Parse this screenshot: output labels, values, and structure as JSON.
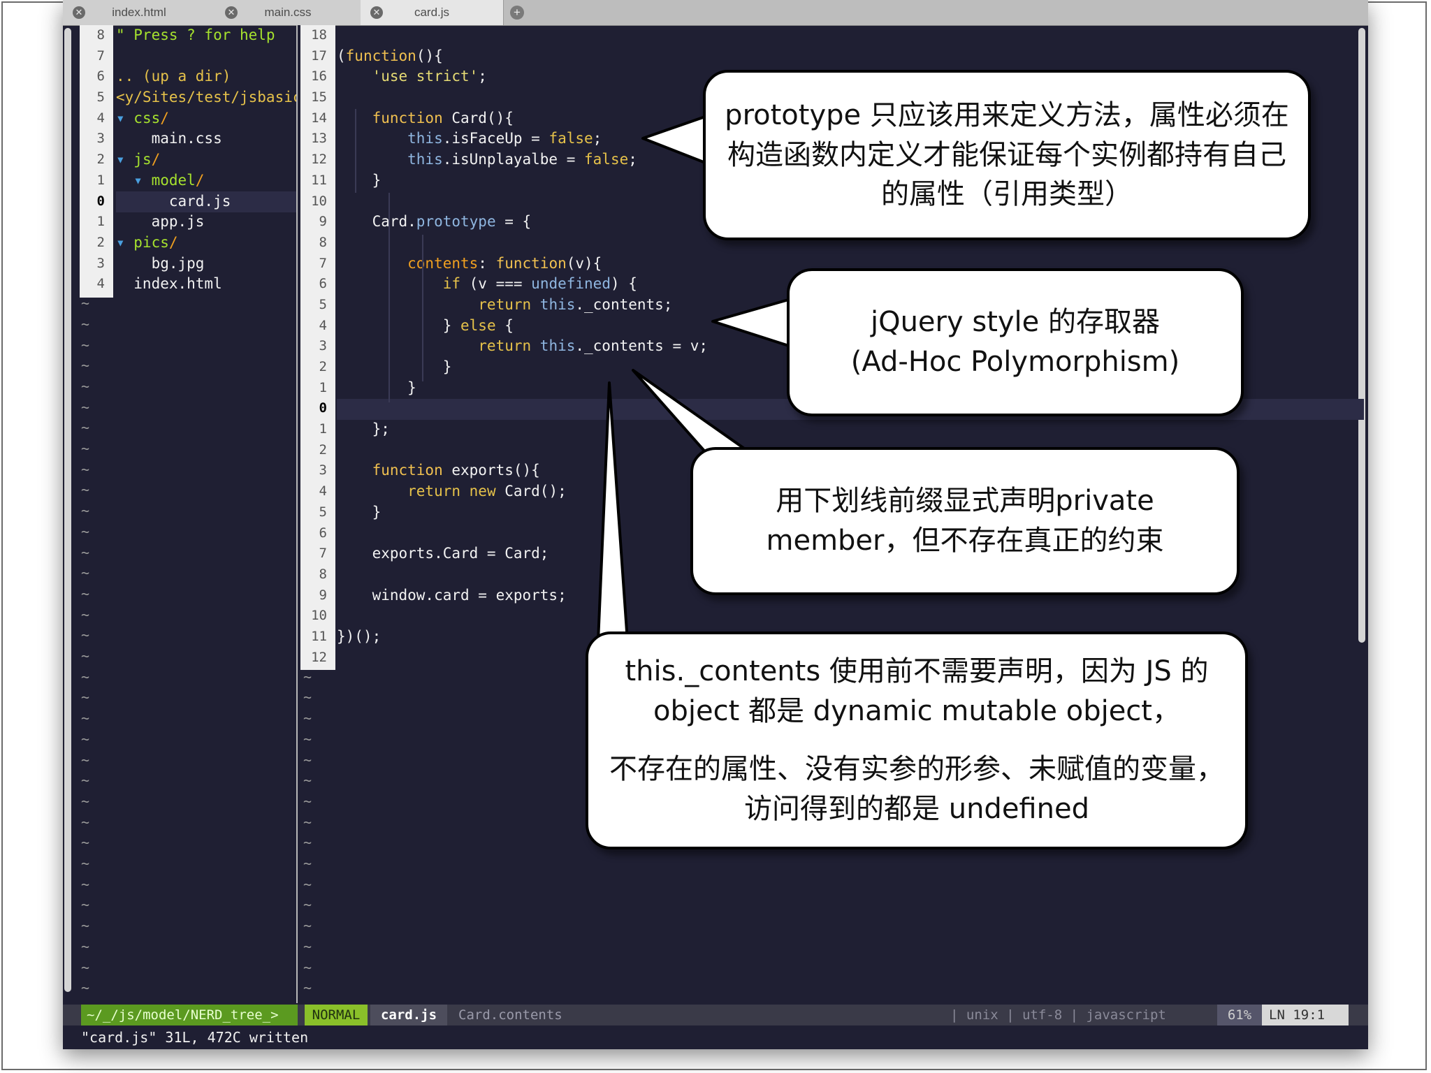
{
  "tabs": [
    {
      "label": "index.html"
    },
    {
      "label": "main.css"
    },
    {
      "label": "card.js"
    }
  ],
  "tree": {
    "line_numbers": [
      "8",
      "7",
      "6",
      "5",
      "4",
      "3",
      "2",
      "1",
      "0",
      "1",
      "2",
      "3",
      "4"
    ],
    "rows": [
      {
        "parts": [
          {
            "t": "\" Press ? for help",
            "c": "grn"
          }
        ]
      },
      {
        "parts": [
          {
            "t": "",
            "c": "wht"
          }
        ]
      },
      {
        "parts": [
          {
            "t": ".. (up a dir)",
            "c": "yel"
          }
        ]
      },
      {
        "parts": [
          {
            "t": "<y/Sites/test/jsbasic/",
            "c": "yel"
          }
        ]
      },
      {
        "parts": [
          {
            "t": "▾ ",
            "c": "blue-arrow"
          },
          {
            "t": "css",
            "c": "grn"
          },
          {
            "t": "/",
            "c": "org"
          }
        ]
      },
      {
        "parts": [
          {
            "t": "    main.css",
            "c": "wht"
          }
        ]
      },
      {
        "parts": [
          {
            "t": "▾ ",
            "c": "blue-arrow"
          },
          {
            "t": "js",
            "c": "grn"
          },
          {
            "t": "/",
            "c": "org"
          }
        ]
      },
      {
        "parts": [
          {
            "t": "  ▾ ",
            "c": "blue-arrow"
          },
          {
            "t": "model",
            "c": "grn"
          },
          {
            "t": "/",
            "c": "org"
          }
        ]
      },
      {
        "parts": [
          {
            "t": "      card.js",
            "c": "wht"
          }
        ]
      },
      {
        "parts": [
          {
            "t": "    app.js",
            "c": "wht"
          }
        ]
      },
      {
        "parts": [
          {
            "t": "▾ ",
            "c": "blue-arrow"
          },
          {
            "t": "pics",
            "c": "grn"
          },
          {
            "t": "/",
            "c": "org"
          }
        ]
      },
      {
        "parts": [
          {
            "t": "    bg.jpg",
            "c": "wht"
          }
        ]
      },
      {
        "parts": [
          {
            "t": "  index.html",
            "c": "wht"
          }
        ]
      }
    ]
  },
  "code": {
    "line_numbers": [
      "18",
      "17",
      "16",
      "15",
      "14",
      "13",
      "12",
      "11",
      "10",
      "9",
      "8",
      "7",
      "6",
      "5",
      "4",
      "3",
      "2",
      "1",
      "0",
      "1",
      "2",
      "3",
      "4",
      "5",
      "6",
      "7",
      "8",
      "9",
      "10",
      "11",
      "12"
    ],
    "rows": [
      {
        "parts": []
      },
      {
        "parts": [
          {
            "t": "(",
            "c": "wht"
          },
          {
            "t": "function",
            "c": "fn"
          },
          {
            "t": "(){",
            "c": "wht"
          }
        ]
      },
      {
        "parts": [
          {
            "t": "    'use strict'",
            "c": "str"
          },
          {
            "t": ";",
            "c": "wht"
          }
        ]
      },
      {
        "parts": []
      },
      {
        "parts": [
          {
            "t": "    ",
            "c": "wht"
          },
          {
            "t": "function",
            "c": "fn"
          },
          {
            "t": " Card(){",
            "c": "wht"
          }
        ]
      },
      {
        "parts": [
          {
            "t": "        this",
            "c": "th"
          },
          {
            "t": ".isFaceUp = ",
            "c": "wht"
          },
          {
            "t": "false",
            "c": "yel"
          },
          {
            "t": ";",
            "c": "wht"
          }
        ]
      },
      {
        "parts": [
          {
            "t": "        this",
            "c": "th"
          },
          {
            "t": ".isUnplayalbe = ",
            "c": "wht"
          },
          {
            "t": "false",
            "c": "yel"
          },
          {
            "t": ";",
            "c": "wht"
          }
        ]
      },
      {
        "parts": [
          {
            "t": "    }",
            "c": "wht"
          }
        ]
      },
      {
        "parts": []
      },
      {
        "parts": [
          {
            "t": "    Card.",
            "c": "wht"
          },
          {
            "t": "prototype",
            "c": "th"
          },
          {
            "t": " = {",
            "c": "wht"
          }
        ]
      },
      {
        "parts": []
      },
      {
        "parts": [
          {
            "t": "        contents",
            "c": "org"
          },
          {
            "t": ": ",
            "c": "wht"
          },
          {
            "t": "function",
            "c": "fn"
          },
          {
            "t": "(v){",
            "c": "wht"
          }
        ]
      },
      {
        "parts": [
          {
            "t": "            if",
            "c": "yel"
          },
          {
            "t": " (v === ",
            "c": "wht"
          },
          {
            "t": "undefined",
            "c": "th"
          },
          {
            "t": ") {",
            "c": "wht"
          }
        ]
      },
      {
        "parts": [
          {
            "t": "                return",
            "c": "yel"
          },
          {
            "t": " this",
            "c": "th"
          },
          {
            "t": "._contents;",
            "c": "wht"
          }
        ]
      },
      {
        "parts": [
          {
            "t": "            } ",
            "c": "wht"
          },
          {
            "t": "else",
            "c": "yel"
          },
          {
            "t": " {",
            "c": "wht"
          }
        ]
      },
      {
        "parts": [
          {
            "t": "                return",
            "c": "yel"
          },
          {
            "t": " this",
            "c": "th"
          },
          {
            "t": "._contents = v;",
            "c": "wht"
          }
        ]
      },
      {
        "parts": [
          {
            "t": "            }",
            "c": "wht"
          }
        ]
      },
      {
        "parts": [
          {
            "t": "        }",
            "c": "wht"
          }
        ]
      },
      {
        "parts": []
      },
      {
        "parts": [
          {
            "t": "    };",
            "c": "wht"
          }
        ]
      },
      {
        "parts": []
      },
      {
        "parts": [
          {
            "t": "    ",
            "c": "wht"
          },
          {
            "t": "function",
            "c": "fn"
          },
          {
            "t": " exports(){",
            "c": "wht"
          }
        ]
      },
      {
        "parts": [
          {
            "t": "        return",
            "c": "yel"
          },
          {
            "t": " new",
            "c": "yel"
          },
          {
            "t": " Card();",
            "c": "wht"
          }
        ]
      },
      {
        "parts": [
          {
            "t": "    }",
            "c": "wht"
          }
        ]
      },
      {
        "parts": []
      },
      {
        "parts": [
          {
            "t": "    exports.Card = Card;",
            "c": "wht"
          }
        ]
      },
      {
        "parts": []
      },
      {
        "parts": [
          {
            "t": "    window.card = exports;",
            "c": "wht"
          }
        ]
      },
      {
        "parts": []
      },
      {
        "parts": [
          {
            "t": "})();",
            "c": "wht"
          }
        ]
      },
      {
        "parts": []
      }
    ]
  },
  "status": {
    "tree": "~/_/js/model/NERD_tree_>",
    "mode": "NORMAL",
    "file": "card.js",
    "func": "Card.contents",
    "right": "| unix | utf-8 | javascript",
    "pct": "61%",
    "pos": "LN  19:1"
  },
  "cmdline": "\"card.js\" 31L, 472C written",
  "callouts": [
    {
      "text": "prototype 只应该用来定义方法，属性必须在构造函数内定义才能保证每个实例都持有自己的属性（引用类型）"
    },
    {
      "line1": "jQuery style 的存取器",
      "line2": "(Ad-Hoc Polymorphism)"
    },
    {
      "text": "用下划线前缀显式声明private member，但不存在真正的约束"
    },
    {
      "line1": "this._contents 使用前不需要声明，因为 JS 的 object 都是 dynamic mutable object，",
      "line2": "不存在的属性、没有实参的形参、未赋值的变量，访问得到的都是 undefined"
    }
  ]
}
